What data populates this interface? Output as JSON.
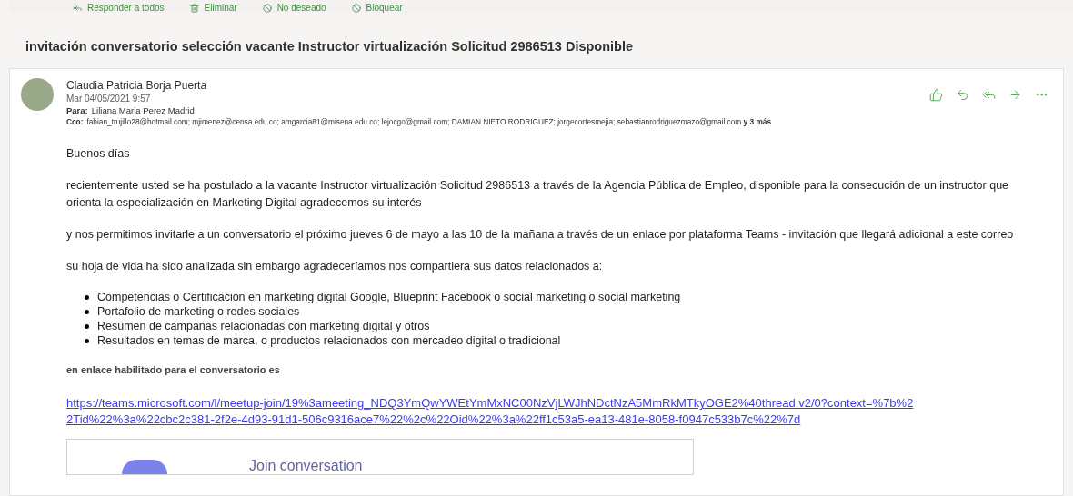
{
  "toolbar": [
    {
      "label": "Responder a todos",
      "kind": "reply-all"
    },
    {
      "label": "Eliminar",
      "kind": "delete"
    },
    {
      "label": "No deseado",
      "kind": "junk"
    },
    {
      "label": "Bloquear",
      "kind": "block"
    }
  ],
  "subject": "invitación conversatorio selección vacante Instructor virtualización Solicitud 2986513 Disponible",
  "message": {
    "sender": "Claudia Patricia Borja Puerta",
    "date": "Mar 04/05/2021 9:57",
    "to_label": "Para:",
    "to": "Liliana Maria Perez Madrid",
    "cc_label": "Cco:",
    "cc": "fabian_trujillo28@hotmail.com; mjimenez@censa.edu.co; amgarcia81@misena.edu.co; lejocgo@gmail.com; DAMIAN NIETO RODRIGUEZ; jorgecortesmejia; sebastianrodriguezmazo@gmail.com **y 3 más**",
    "actions": [
      {
        "kind": "like"
      },
      {
        "kind": "reply"
      },
      {
        "kind": "reply-all"
      },
      {
        "kind": "forward"
      },
      {
        "kind": "more"
      }
    ],
    "body": [
      {
        "kind": "para",
        "text": "Buenos días"
      },
      {
        "kind": "para",
        "text": "recientemente usted se ha postulado a la vacante Instructor virtualización Solicitud 2986513  a través de la Agencia Pública de Empleo,  disponible para la consecución de un instructor que orienta la especialización en Marketing Digital agradecemos su interés"
      },
      {
        "kind": "para",
        "text": "y nos permitimos invitarle a un conversatorio el próximo jueves 6 de mayo a las 10 de la mañana a través de un enlace por plataforma Teams - invitación que llegará adicional a este correo"
      },
      {
        "kind": "para",
        "text": "su hoja de vida ha sido analizada sin embargo agradeceríamos nos compartiera sus datos relacionados a:"
      },
      {
        "kind": "list",
        "items": [
          "Competencias o Certificación en marketing digital Google, Blueprint Facebook o social marketing o social marketing",
          "Portafolio de marketing o redes sociales",
          "Resumen de campañas relacionadas con marketing digital y otros",
          "Resultados en temas de marca, o productos relacionados con mercadeo digital o tradicional"
        ]
      },
      {
        "kind": "bold",
        "text": "en enlace habilitado para el conversatorio es"
      },
      {
        "kind": "link",
        "text": "https://teams.microsoft.com/l/meetup-join/19%3ameeting_NDQ3YmQwYWEtYmMxNC00NzVjLWJhNDctNzA5MmRkMTkyOGE2%40thread.v2/0?context=%7b%22Tid%22%3a%22cbc2c381-2f2e-4d93-91d1-506c9316ace7%22%2c%22Oid%22%3a%22ff1c53a5-ea13-481e-8058-f0947c533b7c%22%7d"
      },
      {
        "kind": "card",
        "text": "Join conversation"
      }
    ]
  }
}
